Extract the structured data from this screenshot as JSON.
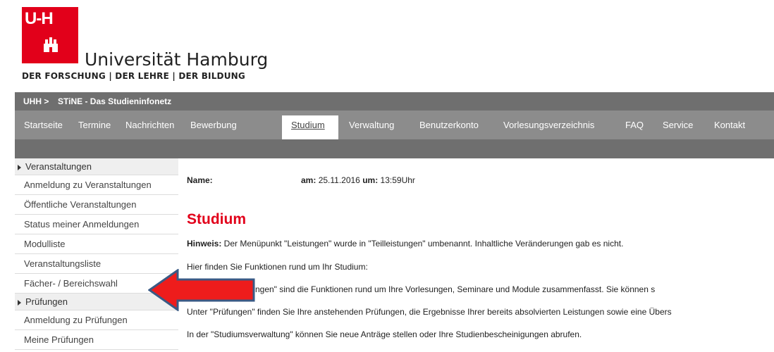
{
  "logo": {
    "mark": "U-H",
    "name": "Universität Hamburg",
    "tagline": "DER FORSCHUNG  |  DER LEHRE  |  DER BILDUNG"
  },
  "breadcrumb": {
    "home": "UHH >",
    "current": "STiNE - Das Studieninfonetz"
  },
  "nav": {
    "items": [
      "Startseite",
      "Termine",
      "Nachrichten",
      "Bewerbung",
      "Studium",
      "Verwaltung",
      "Benutzerkonto",
      "Vorlesungsverzeichnis",
      "FAQ",
      "Service",
      "Kontakt"
    ],
    "active": "Studium"
  },
  "sidebar": {
    "sections": [
      {
        "title": "Veranstaltungen",
        "items": [
          "Anmeldung zu Veranstaltungen",
          "Öffentliche Veranstaltungen",
          "Status meiner Anmeldungen",
          "Modulliste",
          "Veranstaltungsliste",
          "Fächer- / Bereichswahl"
        ]
      },
      {
        "title": "Prüfungen",
        "items": [
          "Anmeldung zu Prüfungen",
          "Meine Prüfungen"
        ]
      }
    ]
  },
  "main": {
    "name_label": "Name:",
    "date_label": "am:",
    "date": "25.11.2016",
    "time_label": "um:",
    "time": "13:59Uhr",
    "title": "Studium",
    "hint_label": "Hinweis:",
    "hint_text": " Der Menüpunkt \"Leistungen\" wurde in \"Teilleistungen\" umbenannt. Inhaltliche Veränderungen gab es nicht.",
    "p1": "Hier finden Sie Funktionen rund um Ihr Studium:",
    "p2": "Unter \"Veranstaltungen\" sind die Funktionen rund um Ihre Vorlesungen, Seminare und Module zusammenfasst. Sie können s",
    "p3": "Unter \"Prüfungen\" finden Sie Ihre anstehenden Prüfungen, die Ergebnisse Ihrer bereits absolvierten Leistungen sowie eine Übers",
    "p4": "In der \"Studiumsverwaltung\" können Sie neue Anträge stellen oder Ihre Studienbescheinigungen abrufen."
  },
  "colors": {
    "brand_red": "#e2001a",
    "bar_dark": "#6f6f6f",
    "bar_nav": "#8c8c8c",
    "arrow_fill": "#ee1c1c",
    "arrow_stroke": "#3a5a85"
  }
}
